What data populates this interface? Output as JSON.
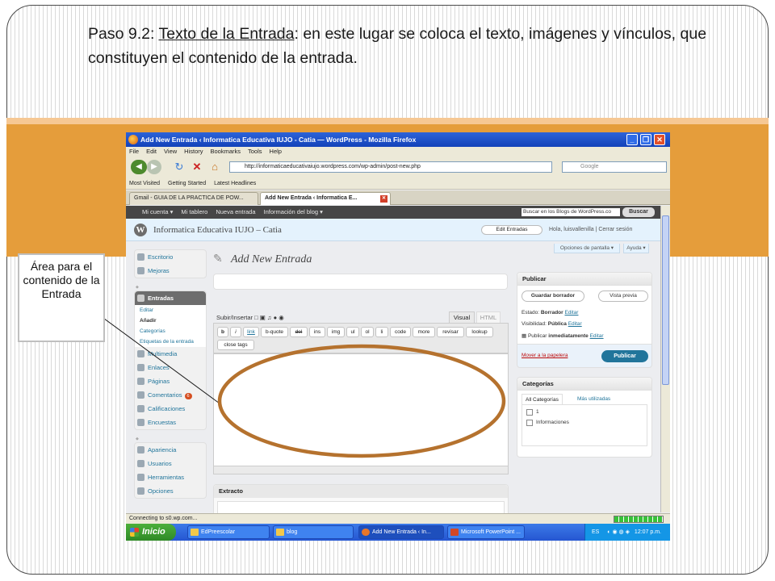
{
  "slide": {
    "heading_prefix": "Paso 9.2: ",
    "heading_link": "Texto de la Entrada",
    "heading_rest": ": en este lugar se coloca el texto, imágenes y vínculos, que constituyen el contenido de la entrada.",
    "callout": "Área para el contenido de la Entrada",
    "accent_color": "#e59d3b",
    "ellipse_color": "#b5722e"
  },
  "browser": {
    "title": "Add New Entrada ‹ Informatica Educativa IUJO - Catia — WordPress - Mozilla Firefox",
    "menu": [
      "File",
      "Edit",
      "View",
      "History",
      "Bookmarks",
      "Tools",
      "Help"
    ],
    "url": "http://informaticaeducativaiujo.wordpress.com/wp-admin/post-new.php",
    "search_placeholder": "Google",
    "bookmarks": [
      "Most Visited",
      "Getting Started",
      "Latest Headlines"
    ],
    "tabs": [
      "Gmail - GUIA DE LA PRACTICA DE POW...",
      "Add New Entrada ‹ Informatica E..."
    ],
    "status": "Connecting to s0.wp.com..."
  },
  "wp": {
    "adminbar": [
      "Mi cuenta ▾",
      "Mi tablero",
      "Nueva entrada",
      "Información del blog ▾"
    ],
    "admin_search_placeholder": "Buscar en los Blogs de WordPress.co",
    "admin_search_button": "Buscar",
    "site_title": "Informatica Educativa IUJO – Catia",
    "edit_entries": "Edit Entradas",
    "hello": "Hola, luisvallenilla | Cerrar sesión",
    "screen_options": "Opciones de pantalla ▾",
    "help": "Ayuda ▾",
    "page_title": "Add New Entrada",
    "upload_label": "Subir/Insertar",
    "visual_tab": "Visual",
    "html_tab": "HTML",
    "quicktags_row1": [
      "b",
      "i",
      "link",
      "b-quote",
      "del",
      "ins",
      "img",
      "ul",
      "ol",
      "li",
      "code",
      "more",
      "revisar",
      "lookup"
    ],
    "quicktags_row2": [
      "close tags"
    ],
    "excerpt_title": "Extracto",
    "menu_top": [
      "Escritorio",
      "Mejoras"
    ],
    "menu_entradas": "Entradas",
    "menu_entradas_sub": [
      "Editar",
      "Añadir",
      "Categorías",
      "Etiquetas de la entrada"
    ],
    "menu_mid": [
      "Multimedia",
      "Enlaces",
      "Páginas",
      "Comentarios",
      "Calificaciones"
    ],
    "comments_badge": "6",
    "menu_encuestas": "Encuestas",
    "menu_bottom": [
      "Apariencia",
      "Usuarios",
      "Herramientas",
      "Opciones"
    ],
    "publish": {
      "title": "Publicar",
      "save_draft": "Guardar borrador",
      "preview": "Vista previa",
      "estado_label": "Estado:",
      "estado_value": "Borrador",
      "visibilidad_label": "Visibilidad:",
      "visibilidad_value": "Pública",
      "publicar_label": "Publicar",
      "publicar_value": "inmediatamente",
      "edit_link": "Editar",
      "trash": "Mover a la papelera",
      "publish_button": "Publicar"
    },
    "categories": {
      "title": "Categorías",
      "tab_all": "All Categorías",
      "tab_used": "Más utilizadas",
      "items": [
        "1",
        "Informaciones"
      ]
    }
  },
  "taskbar": {
    "start": "Inicio",
    "items": [
      "EdPreescolar",
      "blog",
      "Add New Entrada ‹ In...",
      "Microsoft PowerPoint ..."
    ],
    "lang": "ES",
    "clock": "12:07 p.m."
  }
}
